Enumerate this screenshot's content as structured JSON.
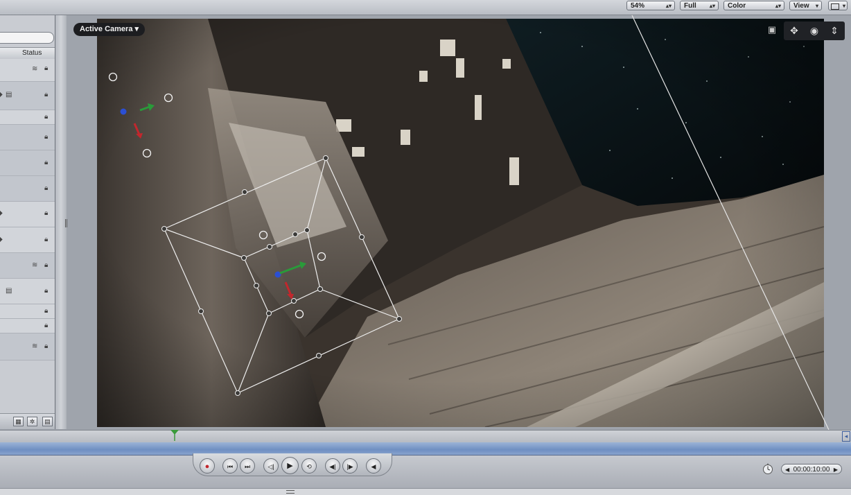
{
  "toolbar": {
    "zoom": "54%",
    "resolution": "Full",
    "channel": "Color",
    "view": "View"
  },
  "layers_panel": {
    "column_header": "Status",
    "rows": [
      {
        "type": "group"
      },
      {
        "type": "layer"
      },
      {
        "type": "layer"
      },
      {
        "type": "layer"
      },
      {
        "type": "layer"
      },
      {
        "type": "layer"
      },
      {
        "type": "layer"
      },
      {
        "type": "layer"
      },
      {
        "type": "group"
      },
      {
        "type": "layer"
      },
      {
        "type": "layer"
      },
      {
        "type": "layer"
      },
      {
        "type": "group"
      }
    ]
  },
  "canvas": {
    "camera_menu": "Active Camera"
  },
  "icons": [
    "camera-icon",
    "move-icon",
    "orbit-icon",
    "dolly-icon",
    "lock-icon",
    "stack-icon",
    "gear-icon",
    "layout-icon"
  ],
  "transport": {
    "timecode": "00:00:10:00"
  },
  "colors": {
    "accent_blue": "#6f8fc2",
    "playhead_green": "#3a9a3a",
    "record_red": "#c2272d"
  }
}
